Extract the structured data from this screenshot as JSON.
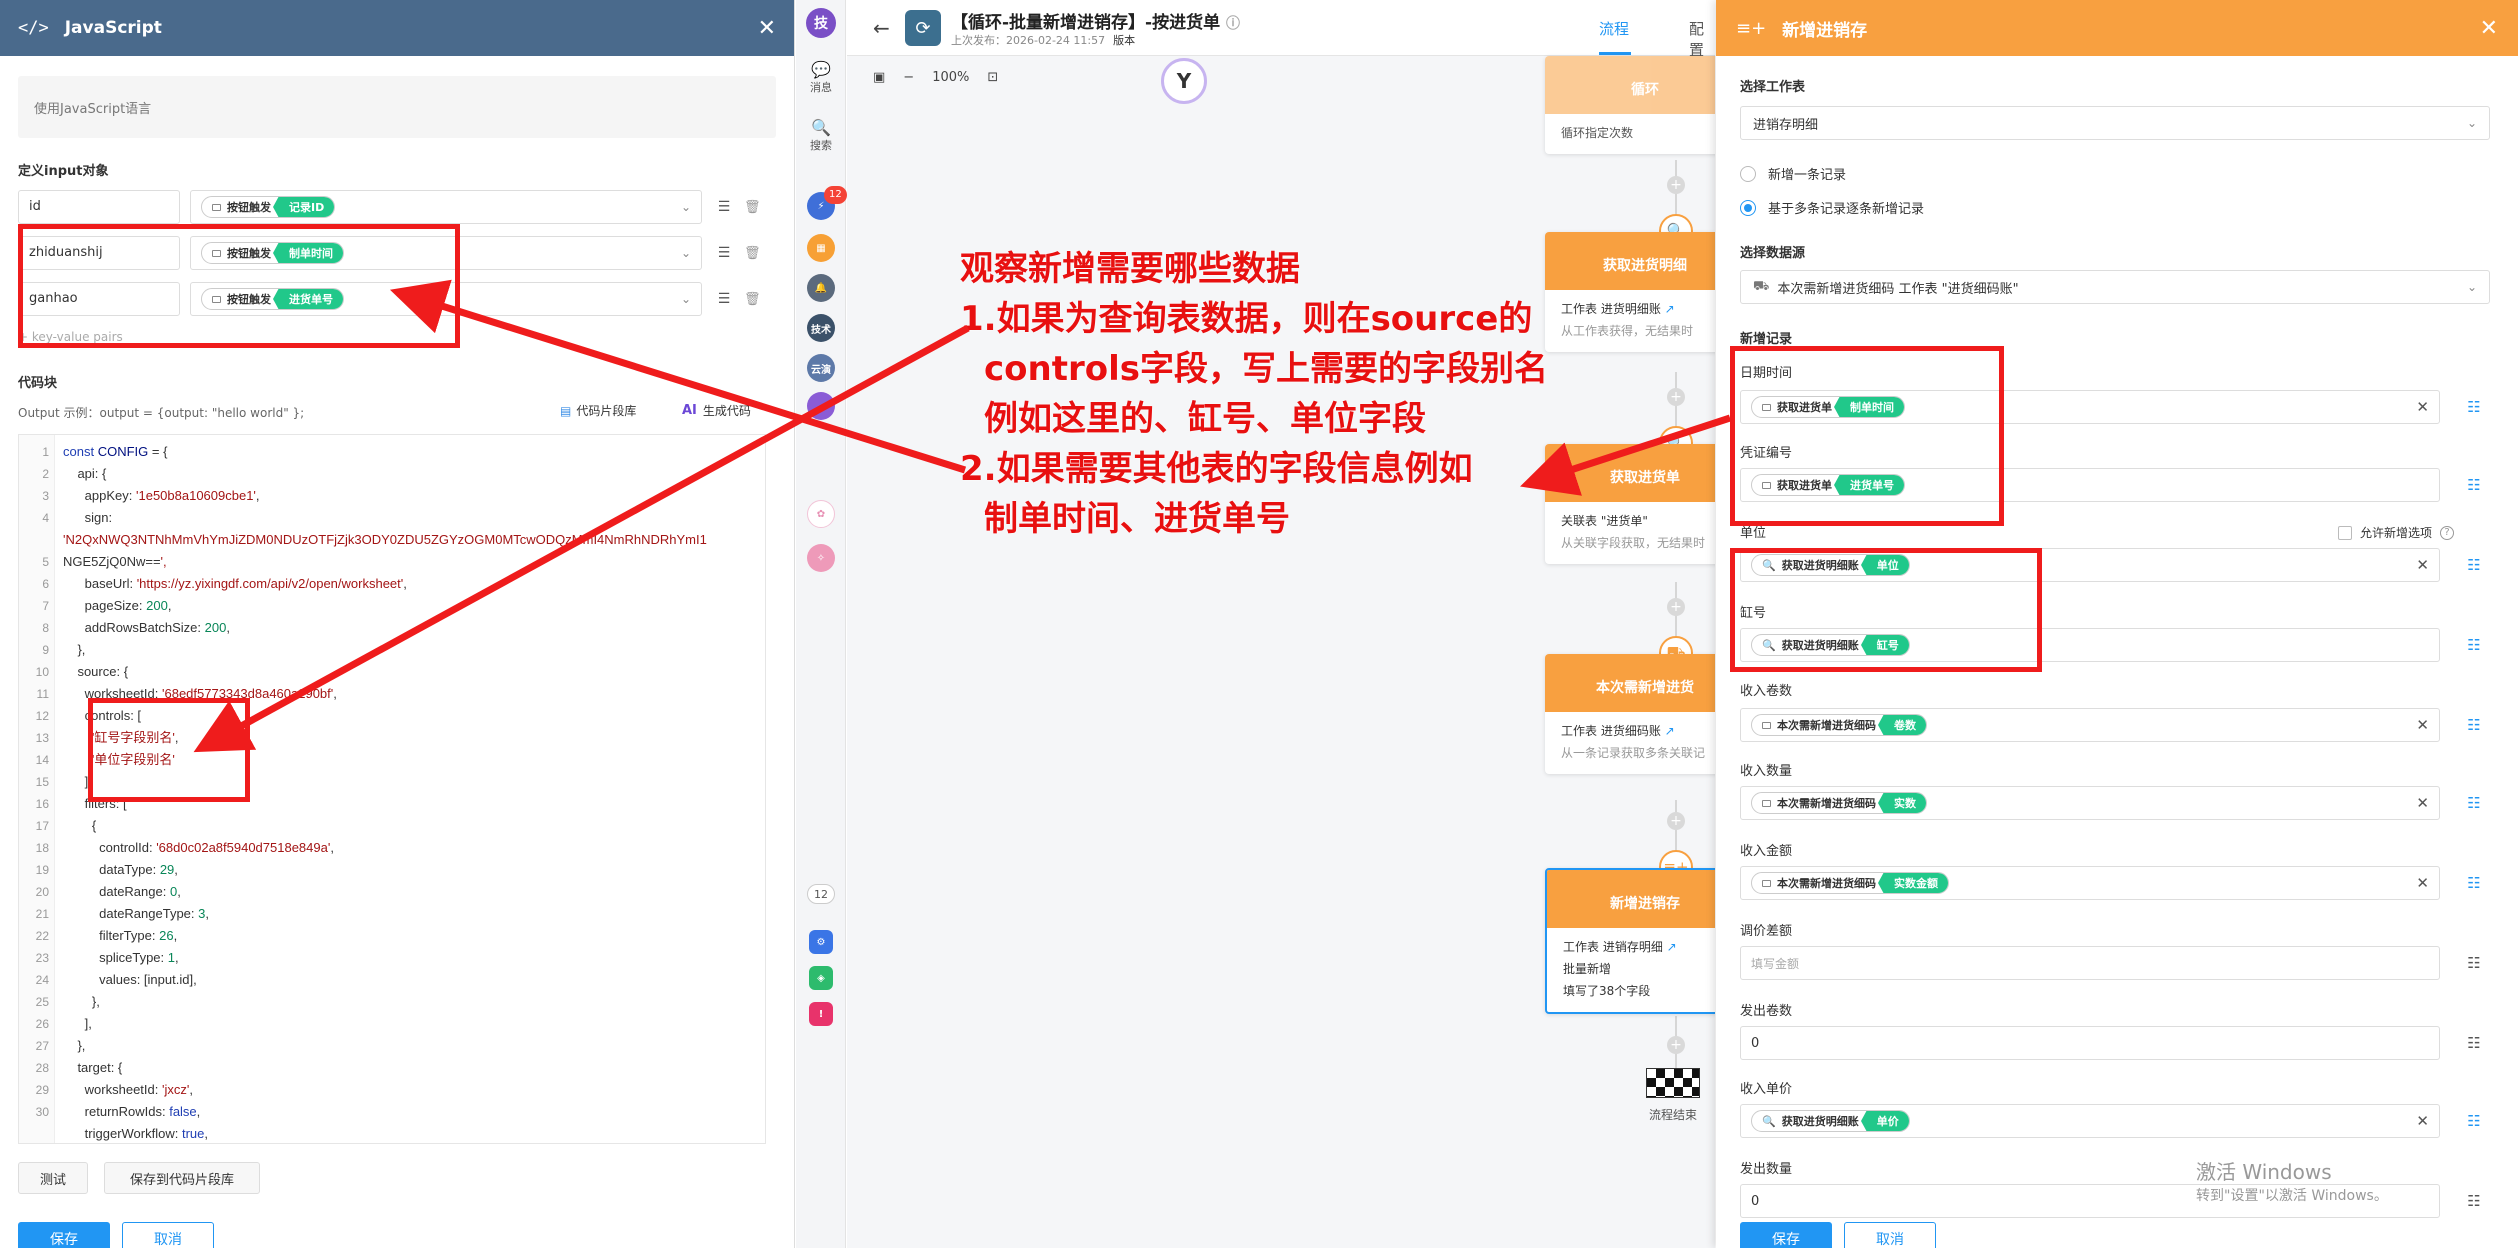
{
  "left_panel": {
    "title": "JavaScript",
    "description": "使用JavaScript语言",
    "input_section_title": "定义input对象",
    "inputs": [
      {
        "name": "id",
        "node": "按钮触发",
        "field": "记录ID"
      },
      {
        "name": "zhiduanshij",
        "node": "按钮触发",
        "field": "制单时间"
      },
      {
        "name": "ganhao",
        "node": "按钮触发",
        "field": "进货单号"
      }
    ],
    "kv_hint": "+ key-value pairs",
    "code_section_title": "代码块",
    "output_hint": "Output 示例：output = {output: \"hello world\" };",
    "snippet_link": "代码片段库",
    "gen_code_link": "生成代码",
    "ai_label": "AI",
    "code_lines": [
      "const CONFIG = {",
      "    api: {",
      "      appKey: '1e50b8a10609cbe1',",
      "      sign:",
      "'N2QxNWQ3NTNhMmVhYmJiZDM0NDUzOTFjZjk3ODY0ZDU5ZGYzOGM0MTcwODQzMmI4NmRhNDRhYmI1",
      "NGE5ZjQ0Nw==',",
      "      baseUrl: 'https://yz.yixingdf.com/api/v2/open/worksheet',",
      "      pageSize: 200,",
      "      addRowsBatchSize: 200,",
      "    },",
      "    source: {",
      "      worksheetId: '68edf5773343d8a460a290bf',",
      "      controls: [",
      "        '缸号字段别名',",
      "        '单位字段别名'",
      "      ],",
      "      filters: [",
      "        {",
      "          controlId: '68d0c02a8f5940d7518e849a',",
      "          dataType: 29,",
      "          dateRange: 0,",
      "          dateRangeType: 3,",
      "          filterType: 26,",
      "          spliceType: 1,",
      "          values: [input.id],",
      "        },",
      "      ],",
      "    },",
      "    target: {",
      "      worksheetId: 'jxcz',",
      "      returnRowIds: false,",
      "      triggerWorkflow: true,"
    ],
    "line_numbers": [
      "1",
      "2",
      "3",
      "4",
      "",
      "5",
      "6",
      "7",
      "8",
      "9",
      "10",
      "11",
      "12",
      "13",
      "14",
      "15",
      "16",
      "17",
      "18",
      "19",
      "20",
      "21",
      "22",
      "23",
      "24",
      "25",
      "26",
      "27",
      "28",
      "29",
      "30"
    ],
    "test_button": "测试",
    "save_snippet_button": "保存到代码片段库",
    "save_button": "保存",
    "cancel_button": "取消"
  },
  "nav": {
    "avatar": "技",
    "messages": "消息",
    "search": "搜索",
    "badge_count": "12",
    "app_tech": "技术",
    "app_cloud": "云演",
    "count_pill": "12"
  },
  "canvas": {
    "title": "【循环-批量新增进销存】-按进货单",
    "meta_published": "上次发布：2026-02-24 11:57",
    "meta_version": "版本",
    "tab_flow": "流程",
    "tab_config": "配置",
    "zoom_level": "100%",
    "cards": [
      {
        "title": "循环",
        "lines": [
          "循环指定次数"
        ]
      },
      {
        "title": "获取进货明细",
        "lines": [
          "工作表 进货明细账",
          "从工作表获得，无结果时"
        ]
      },
      {
        "title": "获取进货单",
        "lines": [
          "关联表 \"进货单\"",
          "从关联字段获取，无结果时"
        ]
      },
      {
        "title": "本次需新增进货",
        "lines": [
          "工作表 进货细码账",
          "从一条记录获取多条关联记"
        ]
      },
      {
        "title": "新增进销存",
        "lines": [
          "工作表 进销存明细",
          "批量新增",
          "填写了38个字段"
        ]
      }
    ],
    "end_label": "流程结束"
  },
  "right_panel": {
    "title": "新增进销存",
    "worksheet_label": "选择工作表",
    "worksheet_value": "进销存明细",
    "radio_single": "新增一条记录",
    "radio_multi": "基于多条记录逐条新增记录",
    "datasource_label": "选择数据源",
    "datasource_value": "本次需新增进货细码 工作表 \"进货细码账\"",
    "new_record_label": "新增记录",
    "allow_new_option": "允许新增选项",
    "fields": [
      {
        "label": "日期时间",
        "node": "获取进货单",
        "field": "制单时间"
      },
      {
        "label": "凭证编号",
        "node": "获取进货单",
        "field": "进货单号"
      },
      {
        "label": "单位",
        "node": "获取进货明细账",
        "field": "单位"
      },
      {
        "label": "缸号",
        "node": "获取进货明细账",
        "field": "缸号"
      },
      {
        "label": "收入卷数",
        "node": "本次需新增进货细码",
        "field": "卷数"
      },
      {
        "label": "收入数量",
        "node": "本次需新增进货细码",
        "field": "实数"
      },
      {
        "label": "收入金额",
        "node": "本次需新增进货细码",
        "field": "实数金额"
      },
      {
        "label": "调价差额",
        "placeholder": "填写金额"
      },
      {
        "label": "发出卷数",
        "value": "0"
      },
      {
        "label": "收入单价",
        "node": "获取进货明细账",
        "field": "单价"
      },
      {
        "label": "发出数量",
        "value": "0"
      }
    ],
    "save_button": "保存",
    "cancel_button": "取消"
  },
  "watermark": {
    "line1": "激活 Windows",
    "line2": "转到\"设置\"以激活 Windows。"
  },
  "annotation": {
    "lines": [
      "观察新增需要哪些数据",
      "1.如果为查询表数据，则在source的",
      "  controls字段，写上需要的字段别名",
      "  例如这里的、缸号、单位字段",
      "2.如果需要其他表的字段信息例如",
      "  制单时间、进货单号"
    ],
    "color": "#e81010"
  },
  "colors": {
    "left_header": "#4a6a8c",
    "right_header": "#f8a040",
    "primary": "#2196f3",
    "tag_green": "#21c88a",
    "annotation_red": "#ef1c1c"
  }
}
